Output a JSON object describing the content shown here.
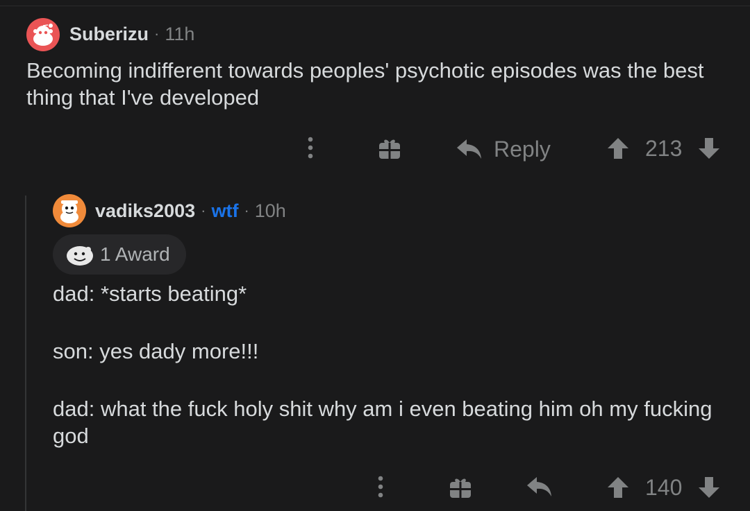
{
  "comments": [
    {
      "author": "Suberizu",
      "separator": "·",
      "time": "11h",
      "body": "Becoming indifferent towards peoples' psychotic episodes was the best thing that I've developed",
      "actions": {
        "more_icon": "more-vertical-icon",
        "gift_icon": "gift-icon",
        "reply_icon": "reply-arrow-icon",
        "reply_label": "Reply",
        "upvote_icon": "upvote-arrow-icon",
        "score": "213",
        "downvote_icon": "downvote-arrow-icon"
      },
      "avatar_color": "#ea5455"
    },
    {
      "author": "vadiks2003",
      "separator": "·",
      "flair": "wtf",
      "time": "10h",
      "award": {
        "icon": "wholesome-award-icon",
        "label": "1 Award"
      },
      "body": [
        "dad: *starts beating*",
        "son: yes dady more!!!",
        "dad: what the fuck holy shit why am i even beating him oh my fucking god"
      ],
      "actions": {
        "more_icon": "more-vertical-icon",
        "gift_icon": "gift-icon",
        "reply_icon": "reply-arrow-icon",
        "upvote_icon": "upvote-arrow-icon",
        "score": "140",
        "downvote_icon": "downvote-arrow-icon"
      },
      "avatar_color": "#f08a3a"
    }
  ],
  "colors": {
    "background": "#1a1a1b",
    "text": "#d7dadc",
    "muted": "#818384",
    "flair": "#1a73e8"
  }
}
